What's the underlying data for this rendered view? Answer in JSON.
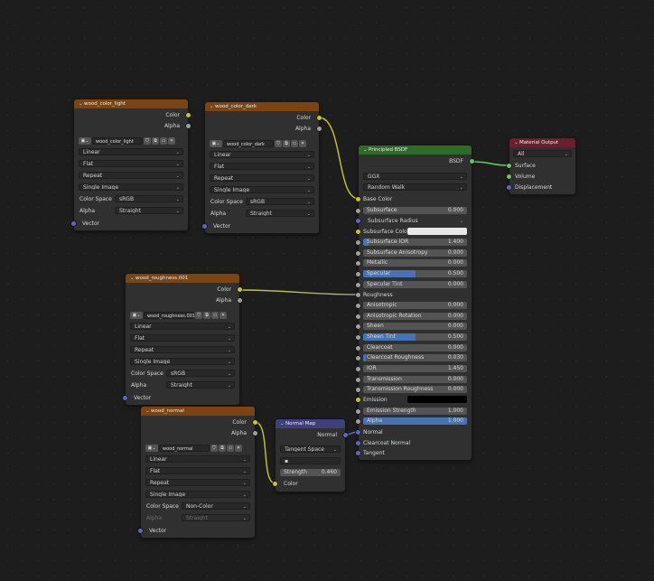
{
  "colors": {
    "texture_header": "#7a4512",
    "bsdf_header": "#306a2a",
    "output_header": "#6a1e2e",
    "vector_header": "#3e3f7e",
    "color_socket": "#c7c729",
    "float_socket": "#a1a1a1",
    "vector_socket": "#6363c7",
    "shader_socket": "#63c763",
    "slider_fill": "#4772b3"
  },
  "wood_color_light": {
    "title": "wood_color_light",
    "out_color": "Color",
    "out_alpha": "Alpha",
    "image": "wood_color_light",
    "interp": "Linear",
    "proj": "Flat",
    "ext": "Repeat",
    "source": "Single Image",
    "cs_label": "Color Space",
    "cs_value": "sRGB",
    "alpha_label": "Alpha",
    "alpha_value": "Straight",
    "in_vector": "Vector"
  },
  "wood_color_dark": {
    "title": "wood_color_dark",
    "out_color": "Color",
    "out_alpha": "Alpha",
    "image": "wood_color_dark",
    "interp": "Linear",
    "proj": "Flat",
    "ext": "Repeat",
    "source": "Single Image",
    "cs_label": "Color Space",
    "cs_value": "sRGB",
    "alpha_label": "Alpha",
    "alpha_value": "Straight",
    "in_vector": "Vector"
  },
  "wood_roughness": {
    "title": "wood_roughness.001",
    "out_color": "Color",
    "out_alpha": "Alpha",
    "image": "wood_roughness.001",
    "interp": "Linear",
    "proj": "Flat",
    "ext": "Repeat",
    "source": "Single Image",
    "cs_label": "Color Space",
    "cs_value": "sRGB",
    "alpha_label": "Alpha",
    "alpha_value": "Straight",
    "in_vector": "Vector"
  },
  "wood_normal": {
    "title": "wood_normal",
    "out_color": "Color",
    "out_alpha": "Alpha",
    "image": "wood_normal",
    "interp": "Linear",
    "proj": "Flat",
    "ext": "Repeat",
    "source": "Single Image",
    "cs_label": "Color Space",
    "cs_value": "Non-Color",
    "alpha_label": "Alpha",
    "alpha_value": "Straight",
    "in_vector": "Vector"
  },
  "normal_map": {
    "title": "Normal Map",
    "out_normal": "Normal",
    "space": "Tangent Space",
    "uv": "",
    "strength_label": "Strength",
    "strength_value": "0.460",
    "in_color": "Color"
  },
  "bsdf": {
    "title": "Principled BSDF",
    "out": "BSDF",
    "distribution": "GGX",
    "subsurface_method": "Random Walk",
    "base_color": "Base Color",
    "subsurface_radius": "Subsurface Radius",
    "subsurface_color": "Subsurface Color",
    "roughness": "Roughness",
    "emission": "Emission",
    "normal": "Normal",
    "clearcoat_normal": "Clearcoat Normal",
    "tangent": "Tangent",
    "sliders": [
      {
        "label": "Subsurface",
        "value": "0.000",
        "fill": 0
      },
      {
        "label": "Subsurface IOR",
        "value": "1.400",
        "fill": 0.05
      },
      {
        "label": "Subsurface Anisotropy",
        "value": "0.000",
        "fill": 0
      },
      {
        "label": "Metallic",
        "value": "0.000",
        "fill": 0
      },
      {
        "label": "Specular",
        "value": "0.500",
        "fill": 0.5
      },
      {
        "label": "Specular Tint",
        "value": "0.000",
        "fill": 0
      },
      {
        "label": "Anisotropic",
        "value": "0.000",
        "fill": 0
      },
      {
        "label": "Anisotropic Rotation",
        "value": "0.000",
        "fill": 0
      },
      {
        "label": "Sheen",
        "value": "0.000",
        "fill": 0
      },
      {
        "label": "Sheen Tint",
        "value": "0.500",
        "fill": 0.5
      },
      {
        "label": "Clearcoat",
        "value": "0.000",
        "fill": 0
      },
      {
        "label": "Clearcoat Roughness",
        "value": "0.030",
        "fill": 0.03
      },
      {
        "label": "IOR",
        "value": "1.450",
        "fill": 0
      },
      {
        "label": "Transmission",
        "value": "0.000",
        "fill": 0
      },
      {
        "label": "Transmission Roughness",
        "value": "0.000",
        "fill": 0
      },
      {
        "label": "Emission Strength",
        "value": "1.000",
        "fill": 0
      },
      {
        "label": "Alpha",
        "value": "1.000",
        "fill": 1
      }
    ]
  },
  "material_output": {
    "title": "Material Output",
    "target": "All",
    "surface": "Surface",
    "volume": "Volume",
    "displacement": "Displacement"
  }
}
